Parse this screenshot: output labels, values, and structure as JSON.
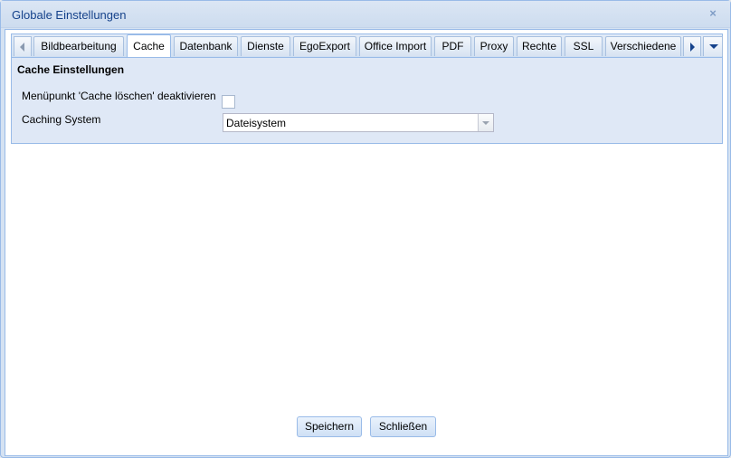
{
  "window": {
    "title": "Globale Einstellungen",
    "close_glyph": "×"
  },
  "tabs": [
    {
      "label": "Bildbearbeitung",
      "active": false
    },
    {
      "label": "Cache",
      "active": true
    },
    {
      "label": "Datenbank",
      "active": false
    },
    {
      "label": "Dienste",
      "active": false
    },
    {
      "label": "EgoExport",
      "active": false
    },
    {
      "label": "Office Import",
      "active": false
    },
    {
      "label": "PDF",
      "active": false
    },
    {
      "label": "Proxy",
      "active": false
    },
    {
      "label": "Rechte",
      "active": false
    },
    {
      "label": "SSL",
      "active": false
    },
    {
      "label": "Verschiedene",
      "active": false
    }
  ],
  "tab_controls": {
    "scroll_left_icon": "triangle-left-icon",
    "scroll_right_icon": "triangle-right-icon",
    "menu_icon": "chevron-down-icon"
  },
  "panel": {
    "title": "Cache Einstellungen",
    "fields": {
      "disable_clear_cache": {
        "label": "Menüpunkt 'Cache löschen' deaktivieren",
        "checked": false
      },
      "caching_system": {
        "label": "Caching System",
        "value": "Dateisystem"
      }
    }
  },
  "buttons": {
    "save": "Speichern",
    "close": "Schließen"
  },
  "colors": {
    "title_text": "#15428b",
    "border": "#99bbe8",
    "panel_bg": "#dfe8f6"
  }
}
